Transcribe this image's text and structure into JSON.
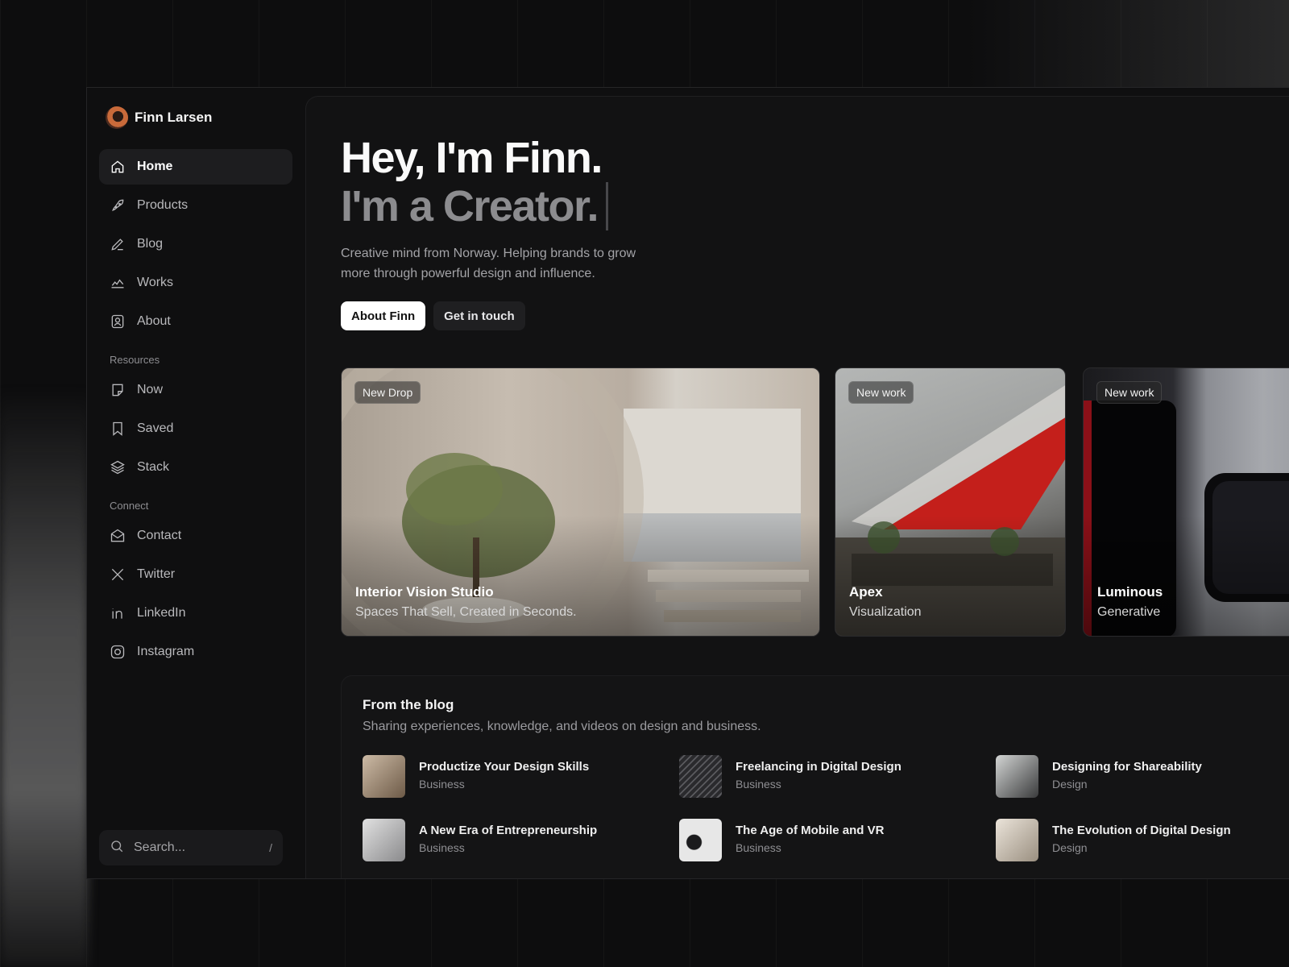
{
  "profile": {
    "name": "Finn Larsen"
  },
  "nav": {
    "main": [
      {
        "label": "Home",
        "icon": "home-icon",
        "active": true
      },
      {
        "label": "Products",
        "icon": "rocket-icon"
      },
      {
        "label": "Blog",
        "icon": "pencil-icon"
      },
      {
        "label": "Works",
        "icon": "chart-icon"
      },
      {
        "label": "About",
        "icon": "user-card-icon"
      }
    ],
    "resources_label": "Resources",
    "resources": [
      {
        "label": "Now",
        "icon": "note-icon"
      },
      {
        "label": "Saved",
        "icon": "bookmark-icon"
      },
      {
        "label": "Stack",
        "icon": "layers-icon"
      }
    ],
    "connect_label": "Connect",
    "connect": [
      {
        "label": "Contact",
        "icon": "mail-icon"
      },
      {
        "label": "Twitter",
        "icon": "x-icon"
      },
      {
        "label": "LinkedIn",
        "icon": "linkedin-icon"
      },
      {
        "label": "Instagram",
        "icon": "instagram-icon"
      }
    ]
  },
  "search": {
    "placeholder": "Search...",
    "shortcut": "/"
  },
  "hero": {
    "title": "Hey, I'm Finn.",
    "subtitle": "I'm a Creator.",
    "description": "Creative mind from Norway. Helping brands to grow more through powerful design and influence.",
    "primary_button": "About Finn",
    "secondary_button": "Get in touch"
  },
  "cards": [
    {
      "badge": "New Drop",
      "title": "Interior Vision Studio",
      "subtitle": "Spaces That Sell, Created in Seconds."
    },
    {
      "badge": "New work",
      "title": "Apex",
      "subtitle": "Visualization"
    },
    {
      "badge": "New work",
      "title": "Luminous",
      "subtitle": "Generative"
    }
  ],
  "blog": {
    "title": "From the blog",
    "subtitle": "Sharing experiences, knowledge, and videos on design and business.",
    "posts": [
      {
        "title": "Productize Your Design Skills",
        "category": "Business"
      },
      {
        "title": "Freelancing in Digital Design",
        "category": "Business"
      },
      {
        "title": "Designing for Shareability",
        "category": "Design"
      },
      {
        "title": "A New Era of Entrepreneurship",
        "category": "Business"
      },
      {
        "title": "The Age of Mobile and VR",
        "category": "Business"
      },
      {
        "title": "The Evolution of Digital Design",
        "category": "Design"
      }
    ]
  }
}
